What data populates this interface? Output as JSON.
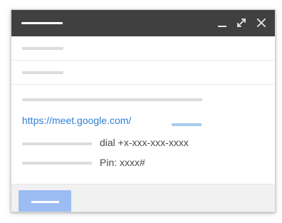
{
  "compose": {
    "window_controls": {
      "minimize_icon": "minimize-icon",
      "expand_icon": "expand-icon",
      "close_icon": "close-icon"
    },
    "body": {
      "meet_link": "https://meet.google.com/",
      "dial_text": "dial +x-xxx-xxx-xxxx",
      "pin_text": "Pin: xxxx#"
    }
  },
  "colors": {
    "titlebar": "#404040",
    "link": "#2f7fd6",
    "send_button": "#9cbdf3",
    "footer": "#f1f1f1"
  }
}
